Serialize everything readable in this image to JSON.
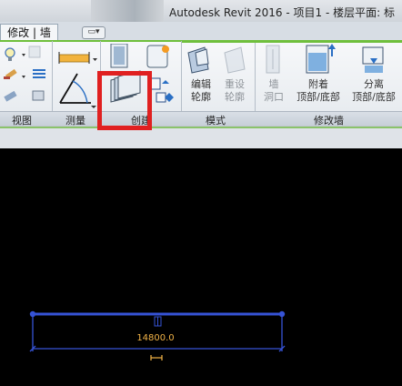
{
  "window": {
    "title": "Autodesk Revit 2016 -    项目1 - 楼层平面: 标"
  },
  "ribbon": {
    "active_tab": "修改 | 墙",
    "extra_tab_icon": "▭▾",
    "panels": {
      "view": "视图",
      "measure": "测量",
      "create": "创建",
      "mode": "模式",
      "modify_wall": "修改墙"
    },
    "tools": {
      "edit_profile": [
        "编辑",
        "轮廓"
      ],
      "reset_profile": [
        "重设",
        "轮廓"
      ],
      "wall_opening": [
        "墙",
        "洞口"
      ],
      "attach": [
        "附着",
        "顶部/底部"
      ],
      "detach": [
        "分离",
        "顶部/底部"
      ]
    }
  },
  "canvas": {
    "dimension_value": "14800.0",
    "wall_color": "#3653d6",
    "dimension_color": "#f2b347"
  },
  "colors": {
    "highlight": "#e02020",
    "panel_green": "#6fbf3c"
  }
}
